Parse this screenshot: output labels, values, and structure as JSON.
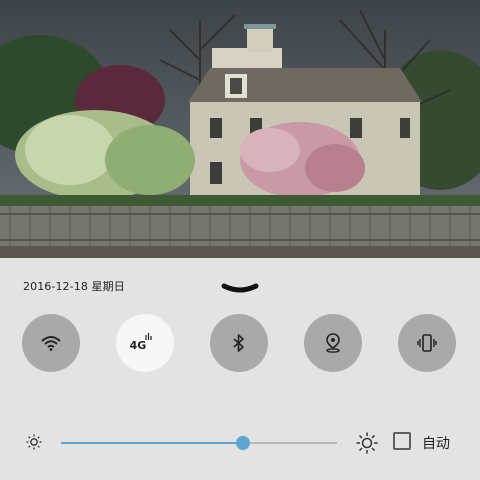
{
  "status": {
    "date_text": "2016-12-18 星期日"
  },
  "quick_toggles": [
    {
      "name": "wifi",
      "icon": "wifi-icon",
      "active": false
    },
    {
      "name": "mobile-data",
      "icon": "4g-icon",
      "label": "4G",
      "active": true
    },
    {
      "name": "bluetooth",
      "icon": "bluetooth-icon",
      "active": false
    },
    {
      "name": "location",
      "icon": "location-pin-icon",
      "active": false
    },
    {
      "name": "vibrate",
      "icon": "vibrate-icon",
      "active": false
    }
  ],
  "brightness": {
    "level": 0.66,
    "auto_label": "自动",
    "auto_checked": false
  },
  "colors": {
    "panel_bg": "#e3e3e3",
    "toggle_off": "#a9a9a9",
    "toggle_on": "#f7f7f7",
    "accent": "#5ea6d0"
  }
}
